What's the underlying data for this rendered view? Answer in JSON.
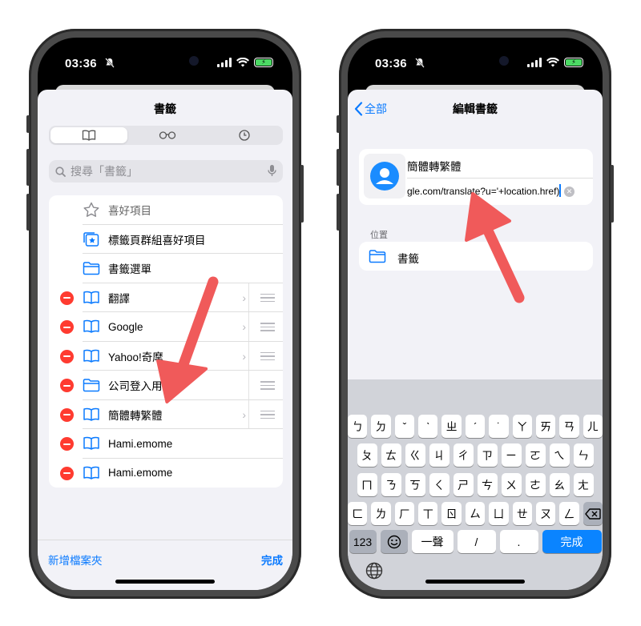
{
  "status": {
    "time": "03:36"
  },
  "left": {
    "title": "書籤",
    "tabs": [
      {
        "icon": "book-icon",
        "label": "📖"
      },
      {
        "icon": "glasses-icon",
        "label": "👓"
      },
      {
        "icon": "clock-icon",
        "label": "🕘"
      }
    ],
    "search_placeholder": "搜尋「書籤」",
    "items": [
      {
        "label": "喜好項目",
        "icon": "star-icon",
        "deletable": false,
        "chevron": false,
        "grip": false,
        "gray": true
      },
      {
        "label": "標籤頁群組喜好項目",
        "icon": "tab-group-star-icon",
        "deletable": false,
        "chevron": false,
        "grip": false,
        "gray": false
      },
      {
        "label": "書籤選單",
        "icon": "folder-icon",
        "deletable": false,
        "chevron": false,
        "grip": false,
        "gray": false
      },
      {
        "label": "翻譯",
        "icon": "book-icon",
        "deletable": true,
        "chevron": true,
        "grip": true,
        "gray": false
      },
      {
        "label": "Google",
        "icon": "book-icon",
        "deletable": true,
        "chevron": true,
        "grip": true,
        "gray": false
      },
      {
        "label": "Yahoo!奇摩",
        "icon": "book-icon",
        "deletable": true,
        "chevron": true,
        "grip": true,
        "gray": false
      },
      {
        "label": "公司登入用",
        "icon": "folder-icon",
        "deletable": true,
        "chevron": false,
        "grip": true,
        "gray": false
      },
      {
        "label": "簡體轉繁體",
        "icon": "book-icon",
        "deletable": true,
        "chevron": true,
        "grip": true,
        "gray": false
      },
      {
        "label": "Hami.emome",
        "icon": "book-icon",
        "deletable": true,
        "chevron": false,
        "grip": false,
        "gray": false
      },
      {
        "label": "Hami.emome",
        "icon": "book-icon",
        "deletable": true,
        "chevron": false,
        "grip": false,
        "gray": false
      }
    ],
    "new_folder": "新增檔案夾",
    "done": "完成"
  },
  "right": {
    "back_label": "全部",
    "title": "編輯書籤",
    "bookmark_name": "簡體轉繁體",
    "bookmark_url": "gle.com/translate?u='+location.href)",
    "location_header": "位置",
    "location_value": "書籤",
    "keyboard": {
      "row1": [
        "ㄅ",
        "ㄉ",
        "ˇ",
        "ˋ",
        "ㄓ",
        "ˊ",
        "˙",
        "ㄚ",
        "ㄞ",
        "ㄢ",
        "ㄦ"
      ],
      "row2": [
        "ㄆ",
        "ㄊ",
        "ㄍ",
        "ㄐ",
        "ㄔ",
        "ㄗ",
        "ㄧ",
        "ㄛ",
        "ㄟ",
        "ㄣ"
      ],
      "row3": [
        "ㄇ",
        "ㄋ",
        "ㄎ",
        "ㄑ",
        "ㄕ",
        "ㄘ",
        "ㄨ",
        "ㄜ",
        "ㄠ",
        "ㄤ"
      ],
      "row4": [
        "ㄈ",
        "ㄌ",
        "ㄏ",
        "ㄒ",
        "ㄖ",
        "ㄙ",
        "ㄩ",
        "ㄝ",
        "ㄡ",
        "ㄥ"
      ],
      "numbers": "123",
      "tone_first": "一聲",
      "slash": "/",
      "dot": ".",
      "done": "完成"
    }
  },
  "colors": {
    "accent": "#0a7aff",
    "delete": "#ff3b30",
    "arrow": "#f05a5a",
    "phone_frame": "#4a4a4a"
  }
}
